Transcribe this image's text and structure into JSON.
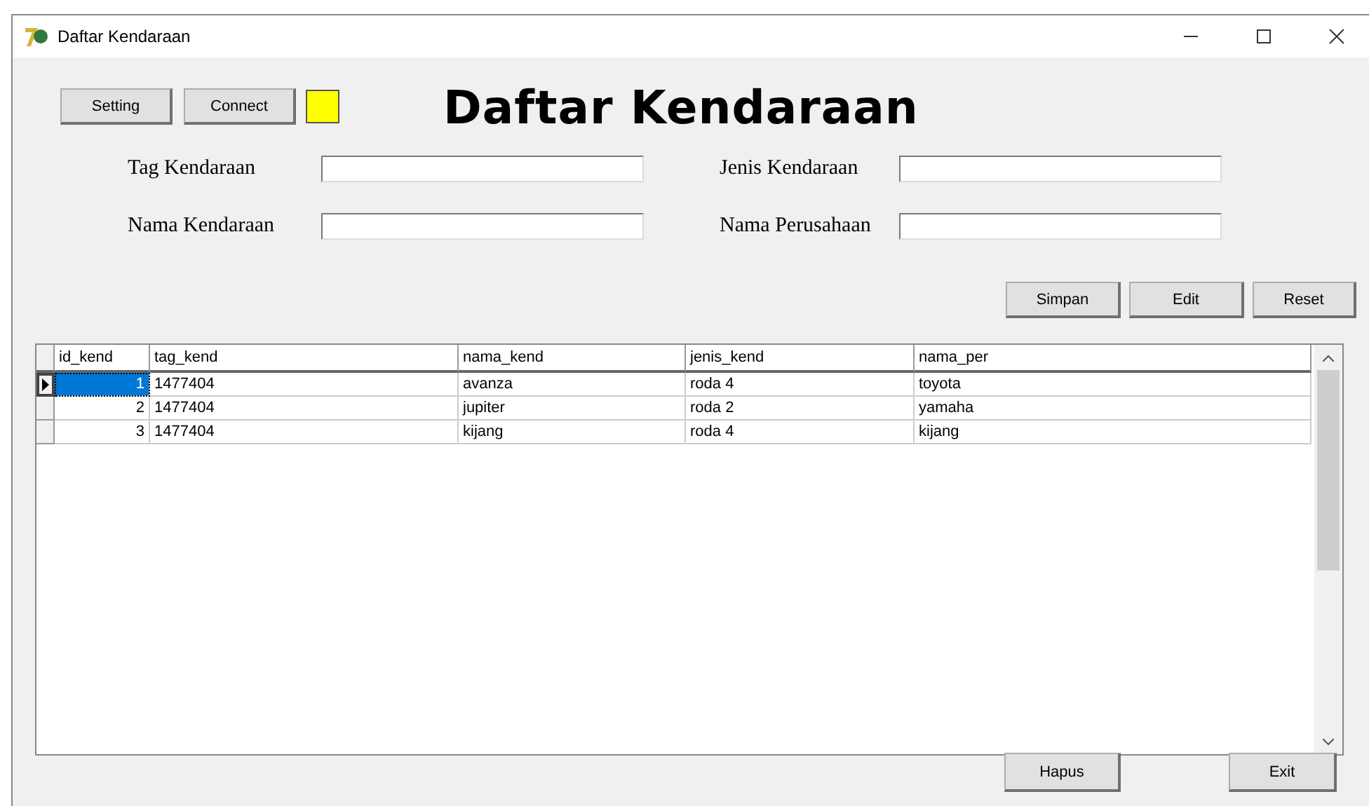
{
  "window": {
    "title": "Daftar Kendaraan"
  },
  "toolbar": {
    "buttons": [
      "Setting",
      "Connect"
    ],
    "status_indicator": {
      "color": "#ffff00"
    }
  },
  "heading": "Daftar Kendaraan",
  "fields": [
    {
      "label": "Tag Kendaraan"
    },
    {
      "label": "Jenis Kendaraan"
    },
    {
      "label": "Nama Kendaraan"
    },
    {
      "label": "Nama Perusahaan"
    }
  ],
  "form_buttons": [
    "Simpan",
    "Edit",
    "Reset"
  ],
  "table": {
    "columns": [
      "id_kend",
      "tag_kend",
      "nama_kend",
      "jenis_kend",
      "nama_per"
    ],
    "rows": [
      {
        "selected": true,
        "cells": [
          "1",
          "1477404",
          "avanza",
          "roda 4",
          "toyota"
        ]
      },
      {
        "selected": false,
        "cells": [
          "2",
          "1477404",
          "jupiter",
          "roda 2",
          "yamaha"
        ]
      },
      {
        "selected": false,
        "cells": [
          "3",
          "1477404",
          "kijang",
          "roda 4",
          "kijang"
        ]
      }
    ]
  },
  "bottom_buttons": [
    "Hapus",
    "Exit"
  ]
}
